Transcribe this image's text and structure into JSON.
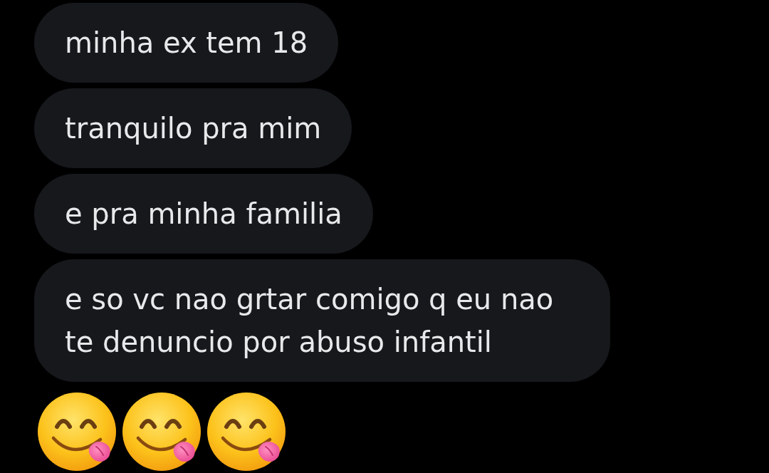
{
  "messages": [
    {
      "kind": "text",
      "text": "minha ex tem 18"
    },
    {
      "kind": "text",
      "text": "tranquilo pra mim"
    },
    {
      "kind": "text",
      "text": "e pra minha familia"
    },
    {
      "kind": "text",
      "text": "e so vc nao grtar comigo q eu nao te denuncio por abuso infantil"
    },
    {
      "kind": "emojis",
      "items": [
        {
          "kind": "savoring"
        },
        {
          "kind": "savoring"
        },
        {
          "kind": "savoring"
        }
      ]
    }
  ]
}
